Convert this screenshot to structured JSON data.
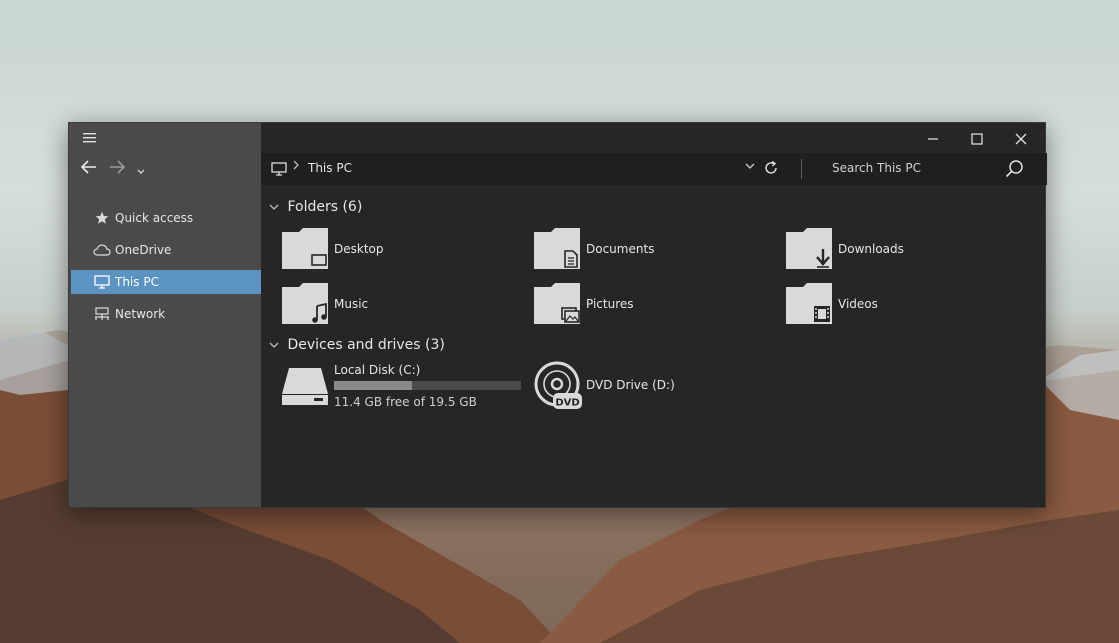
{
  "window": {
    "controls": {
      "minimize": "minimize-icon",
      "maximize": "maximize-icon",
      "close": "close-icon"
    }
  },
  "sidebar": {
    "items": [
      {
        "label": "Quick access",
        "icon": "star-icon",
        "active": false
      },
      {
        "label": "OneDrive",
        "icon": "cloud-icon",
        "active": false
      },
      {
        "label": "This PC",
        "icon": "computer-icon",
        "active": true
      },
      {
        "label": "Network",
        "icon": "network-icon",
        "active": false
      }
    ]
  },
  "addressbar": {
    "location": "This PC",
    "search_placeholder": "Search This PC"
  },
  "content": {
    "folders_header": "Folders (6)",
    "devices_header": "Devices and drives (3)",
    "folders": [
      {
        "label": "Desktop",
        "icon": "desktop-folder-icon"
      },
      {
        "label": "Documents",
        "icon": "documents-folder-icon"
      },
      {
        "label": "Downloads",
        "icon": "downloads-folder-icon"
      },
      {
        "label": "Music",
        "icon": "music-folder-icon"
      },
      {
        "label": "Pictures",
        "icon": "pictures-folder-icon"
      },
      {
        "label": "Videos",
        "icon": "videos-folder-icon"
      }
    ],
    "drives": {
      "local": {
        "label": "Local Disk (C:)",
        "free_text": "11.4 GB free of 19.5 GB",
        "used_fraction": 0.415
      },
      "dvd": {
        "label": "DVD Drive (D:)",
        "badge": "DVD"
      }
    }
  },
  "colors": {
    "accent": "#5b93c2",
    "window_bg": "#262626",
    "sidebar_bg": "#4a4a4a",
    "icon_fill": "#d9d9d9"
  }
}
